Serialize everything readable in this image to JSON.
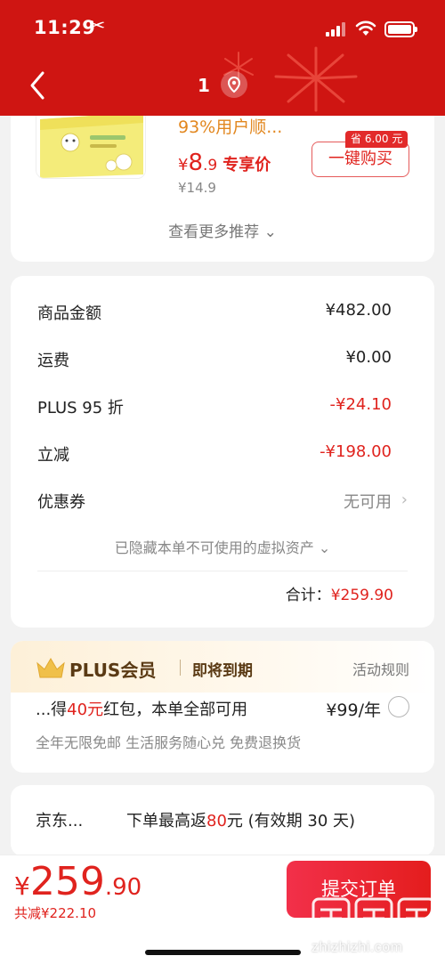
{
  "status_bar": {
    "time": "11:29"
  },
  "nav": {
    "title": "1"
  },
  "recommend": {
    "product_desc": "93%用户顺...",
    "price_symbol": "¥",
    "price_int": "8",
    "price_dec": ".9",
    "price_tag": "专享价",
    "original_price": "¥14.9",
    "save_badge": "省 6.00 元",
    "buy_button": "一键购买",
    "more_link": "查看更多推荐 ⌄"
  },
  "summary": {
    "rows": [
      {
        "label": "商品金额",
        "value": "¥482.00"
      },
      {
        "label": "运费",
        "value": "¥0.00"
      },
      {
        "label": "PLUS 95 折",
        "value": "-¥24.10"
      },
      {
        "label": "立减",
        "value": "-¥198.00"
      },
      {
        "label": "优惠券",
        "value": "无可用"
      }
    ],
    "hidden_assets": "已隐藏本单不可使用的虚拟资产 ⌄",
    "total_label": "合计：",
    "total_value": "¥259.90"
  },
  "plus": {
    "title": "PLUS会员",
    "status": "即将到期",
    "rules": "活动规则",
    "offer_prefix": "...得",
    "offer_amount": "40元",
    "offer_suffix": "红包，本单全部可用",
    "price": "¥99/年",
    "benefits": "全年无限免邮  生活服务随心兑  免费退换货"
  },
  "jd": {
    "label": "京东...",
    "rebate_prefix": "下单最高返",
    "rebate_amount": "80",
    "rebate_suffix": "元 (有效期 30 天)"
  },
  "bottom": {
    "price_symbol": "¥",
    "price_int": "259",
    "price_dec": ".90",
    "saved": "共减¥222.10",
    "submit_button": "提交订单"
  },
  "watermark": {
    "text": "zhizhizhi.com"
  },
  "colors": {
    "brand_red": "#cf1512",
    "price_red": "#e0231e",
    "plus_gold": "#5a3a14"
  }
}
